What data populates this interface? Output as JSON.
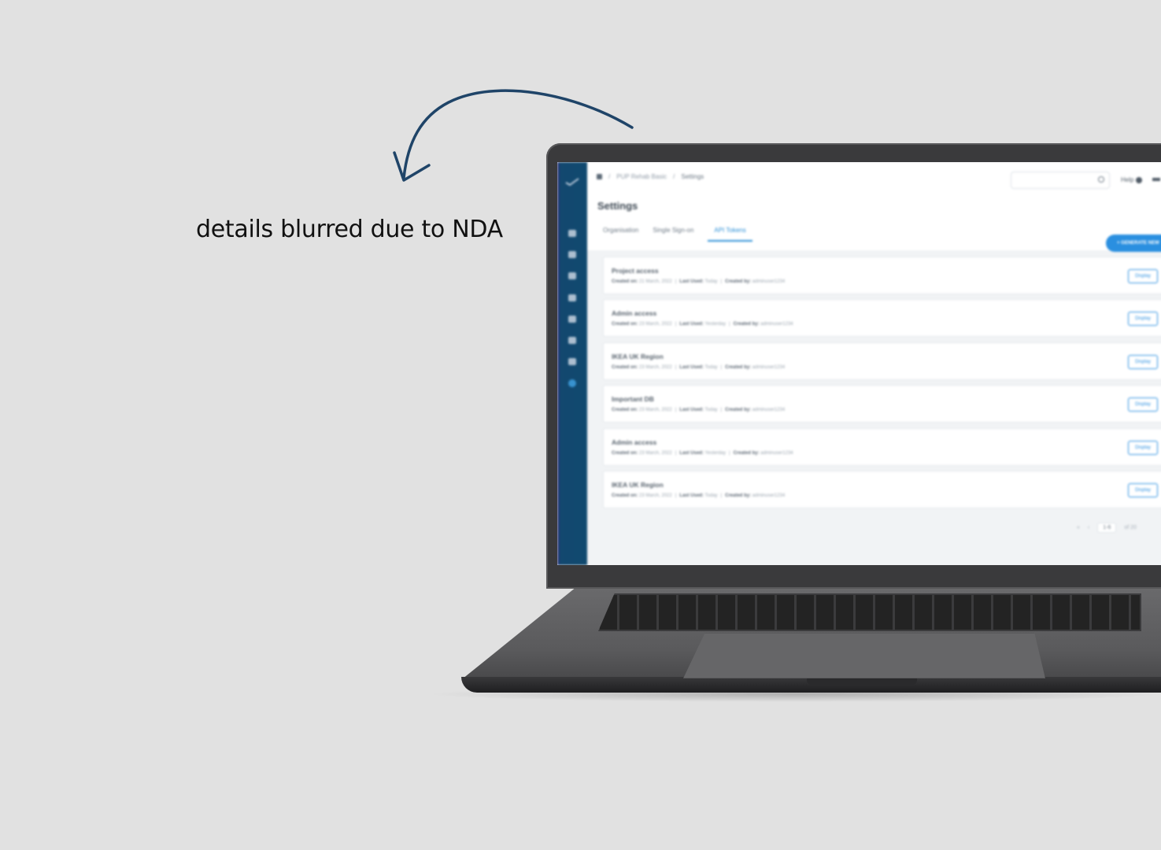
{
  "caption": "details blurred due to NDA",
  "app": {
    "breadcrumb": [
      "PUP Rehab Basic",
      "Settings"
    ],
    "search_placeholder": "",
    "help_label": "Help",
    "page_title": "Settings",
    "tabs": [
      {
        "label": "Organisation",
        "active": false
      },
      {
        "label": "Single Sign-on",
        "active": false
      },
      {
        "label": "API Tokens",
        "active": true
      }
    ],
    "generate_button": "+ GENERATE NEW",
    "meta_labels": {
      "created": "Created on:",
      "last_used": "Last Used:",
      "created_by": "Created by:"
    },
    "display_label": "Display",
    "tokens": [
      {
        "name": "Project access",
        "created_on": "21 March, 2022",
        "last_used": "Today",
        "created_by": "adminuser1234"
      },
      {
        "name": "Admin access",
        "created_on": "23 March, 2022",
        "last_used": "Yesterday",
        "created_by": "adminuser1234"
      },
      {
        "name": "IKEA UK Region",
        "created_on": "23 March, 2022",
        "last_used": "Today",
        "created_by": "adminuser1234"
      },
      {
        "name": "Important DB",
        "created_on": "23 March, 2022",
        "last_used": "Today",
        "created_by": "adminuser1234"
      },
      {
        "name": "Admin access",
        "created_on": "23 March, 2022",
        "last_used": "Yesterday",
        "created_by": "adminuser1234"
      },
      {
        "name": "IKEA UK Region",
        "created_on": "23 March, 2022",
        "last_used": "Today",
        "created_by": "adminuser1234"
      }
    ],
    "pagination": {
      "range": "1-6",
      "total": "of 20"
    }
  },
  "colors": {
    "background": "#e1e1e1",
    "sidebar": "#10496f",
    "accent": "#2a8fe0",
    "arrow": "#1f4468"
  }
}
